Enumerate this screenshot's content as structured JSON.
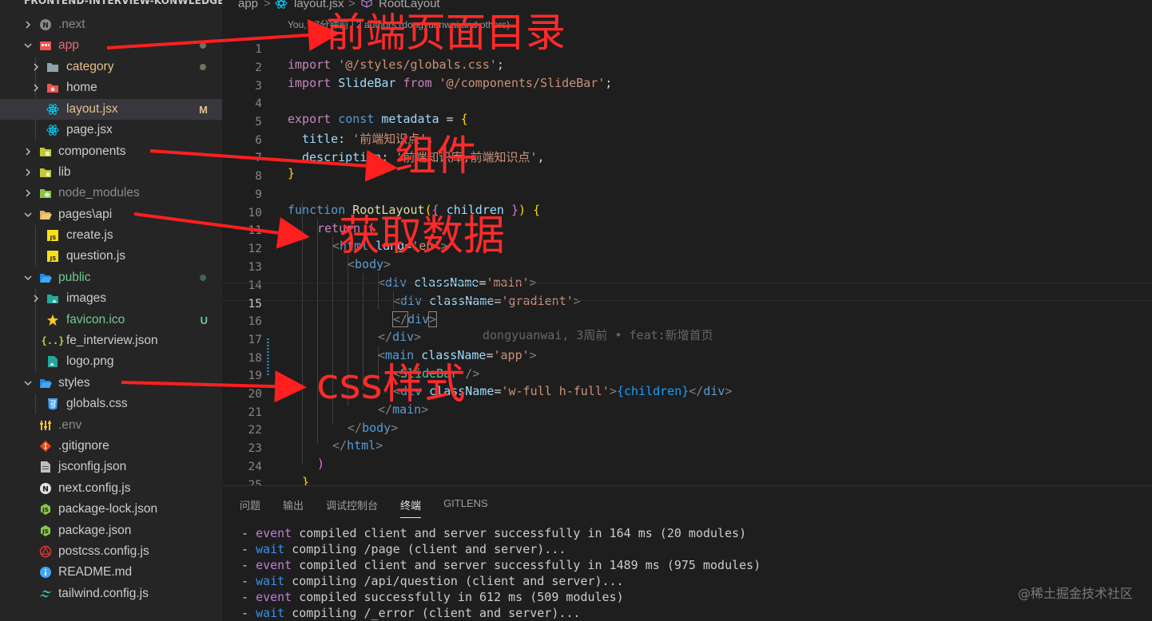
{
  "explorer": {
    "root_title": "FRONTEND-INTERVIEW-KONWLEDGE",
    "items": [
      {
        "label": ".next",
        "badge": ""
      },
      {
        "label": "app",
        "badge": ""
      },
      {
        "label": "category",
        "badge": ""
      },
      {
        "label": "home",
        "badge": ""
      },
      {
        "label": "layout.jsx",
        "badge": "M"
      },
      {
        "label": "page.jsx",
        "badge": ""
      },
      {
        "label": "components",
        "badge": ""
      },
      {
        "label": "lib",
        "badge": ""
      },
      {
        "label": "node_modules",
        "badge": ""
      },
      {
        "label": "pages\\api",
        "badge": ""
      },
      {
        "label": "create.js",
        "badge": ""
      },
      {
        "label": "question.js",
        "badge": ""
      },
      {
        "label": "public",
        "badge": ""
      },
      {
        "label": "images",
        "badge": ""
      },
      {
        "label": "favicon.ico",
        "badge": "U"
      },
      {
        "label": "fe_interview.json",
        "badge": ""
      },
      {
        "label": "logo.png",
        "badge": ""
      },
      {
        "label": "styles",
        "badge": ""
      },
      {
        "label": "globals.css",
        "badge": ""
      },
      {
        "label": ".env",
        "badge": ""
      },
      {
        "label": ".gitignore",
        "badge": ""
      },
      {
        "label": "jsconfig.json",
        "badge": ""
      },
      {
        "label": "next.config.js",
        "badge": ""
      },
      {
        "label": "package-lock.json",
        "badge": ""
      },
      {
        "label": "package.json",
        "badge": ""
      },
      {
        "label": "postcss.config.js",
        "badge": ""
      },
      {
        "label": "README.md",
        "badge": ""
      },
      {
        "label": "tailwind.config.js",
        "badge": ""
      }
    ]
  },
  "breadcrumb": {
    "folder": "app",
    "sep1": ">",
    "file": "layout.jsx",
    "sep2": ">",
    "symbol": "RootLayout"
  },
  "editor": {
    "codelens": "You, 37分钟前 | 2 authors (dongyuanwai and others)",
    "line_numbers": [
      "1",
      "2",
      "3",
      "4",
      "5",
      "6",
      "7",
      "8",
      "9",
      "10",
      "11",
      "12",
      "13",
      "14",
      "15",
      "16",
      "17",
      "18",
      "19",
      "20",
      "21",
      "22",
      "23",
      "24",
      "25"
    ],
    "current_line": "15",
    "blame": "dongyuanwai, 3周前 • feat:新增首页",
    "code": {
      "l1_import": "import",
      "l1_path": "'@/styles/globals.css'",
      "l1_semi": ";",
      "l2_import": "import",
      "l2_name": "SlideBar",
      "l2_from": "from",
      "l2_path": "'@/components/SlideBar'",
      "l2_semi": ";",
      "l4_export": "export",
      "l4_const": "const",
      "l4_name": "metadata",
      "l4_eq": " = ",
      "l4_brace": "{",
      "l5_key": "title",
      "l5_val": "'前端知识点'",
      "l6_key": "description",
      "l6_val": "'前端知识库,前端知识点'",
      "l7_brace": "}",
      "l9_function": "function",
      "l9_name": "RootLayout",
      "l9_open": "(",
      "l9_brace1": "{ ",
      "l9_param": "children",
      "l9_brace2": " }",
      "l9_close": ")",
      "l9_body": "{",
      "l10_return": "return",
      "l10_paren": "(",
      "l11_open": "<",
      "l11_tag": "html",
      "l11_attr": "lang",
      "l11_val": "'en'",
      "l11_close": ">",
      "l12_open": "<",
      "l12_tag": "body",
      "l12_close": ">",
      "l13_open": "<",
      "l13_tag": "div",
      "l13_attr": "className",
      "l13_val": "'main'",
      "l13_close": ">",
      "l14_open": "<",
      "l14_tag": "div",
      "l14_attr": "className",
      "l14_val": "'gradient'",
      "l14_close": ">",
      "l15_open": "</",
      "l15_tag": "div",
      "l15_close": ">",
      "l16_open": "</",
      "l16_tag": "div",
      "l16_close": ">",
      "l17_open": "<",
      "l17_tag": "main",
      "l17_attr": "className",
      "l17_val": "'app'",
      "l17_close": ">",
      "l18_open": "<",
      "l18_tag": "SlideBar",
      "l18_close": " />",
      "l19_open": "<",
      "l19_tag": "div",
      "l19_attr": "className",
      "l19_val": "'w-full h-full'",
      "l19_expr": "{children}",
      "l19_close_open": "</",
      "l19_close_tag": "div",
      "l19_close": ">",
      "l20_open": "</",
      "l20_tag": "main",
      "l20_close": ">",
      "l21_open": "</",
      "l21_tag": "body",
      "l21_close": ">",
      "l22_open": "</",
      "l22_tag": "html",
      "l22_close": ">",
      "l23_paren": ")",
      "l24_brace": "}"
    }
  },
  "panel": {
    "tabs": [
      "问题",
      "输出",
      "调试控制台",
      "终端",
      "GITLENS"
    ],
    "active_tab": "终端",
    "terminal": [
      {
        "kind": "event",
        "rest": "compiled client and server successfully in 164 ms (20 modules)"
      },
      {
        "kind": "wait",
        "rest": "compiling /page (client and server)..."
      },
      {
        "kind": "event",
        "rest": "compiled client and server successfully in 1489 ms (975 modules)"
      },
      {
        "kind": "wait",
        "rest": "compiling /api/question (client and server)..."
      },
      {
        "kind": "event",
        "rest": "compiled successfully in 612 ms (509 modules)"
      },
      {
        "kind": "wait",
        "rest": "compiling /_error (client and server)..."
      }
    ]
  },
  "annotations": {
    "a1": "前端页面目录",
    "a2": "组件",
    "a3": "获取数据",
    "a4": "css样式"
  },
  "watermark": "@稀土掘金技术社区",
  "colors": {
    "annotation": "#ff2b2b",
    "modified": "#e2c08d",
    "untracked": "#73c991",
    "folder_icon": "#90a4ae",
    "react_icon": "#00d8ff"
  }
}
